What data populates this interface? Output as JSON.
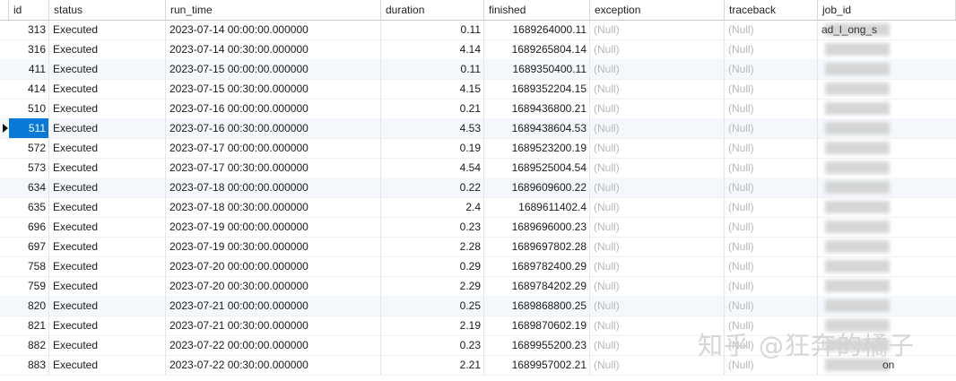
{
  "columns": [
    "id",
    "status",
    "run_time",
    "duration",
    "finished",
    "exception",
    "traceback",
    "job_id"
  ],
  "rows": [
    {
      "id": "313",
      "status": "Executed",
      "run_time": "2023-07-14 00:00:00.000000",
      "duration": "0.11",
      "finished": "1689264000.11",
      "exception": "(Null)",
      "traceback": "(Null)",
      "job_id": "ad_l_ong_s"
    },
    {
      "id": "316",
      "status": "Executed",
      "run_time": "2023-07-14 00:30:00.000000",
      "duration": "4.14",
      "finished": "1689265804.14",
      "exception": "(Null)",
      "traceback": "(Null)",
      "job_id": ""
    },
    {
      "id": "411",
      "status": "Executed",
      "run_time": "2023-07-15 00:00:00.000000",
      "duration": "0.11",
      "finished": "1689350400.11",
      "exception": "(Null)",
      "traceback": "(Null)",
      "job_id": ""
    },
    {
      "id": "414",
      "status": "Executed",
      "run_time": "2023-07-15 00:30:00.000000",
      "duration": "4.15",
      "finished": "1689352204.15",
      "exception": "(Null)",
      "traceback": "(Null)",
      "job_id": ""
    },
    {
      "id": "510",
      "status": "Executed",
      "run_time": "2023-07-16 00:00:00.000000",
      "duration": "0.21",
      "finished": "1689436800.21",
      "exception": "(Null)",
      "traceback": "(Null)",
      "job_id": ""
    },
    {
      "id": "511",
      "status": "Executed",
      "run_time": "2023-07-16 00:30:00.000000",
      "duration": "4.53",
      "finished": "1689438604.53",
      "exception": "(Null)",
      "traceback": "(Null)",
      "job_id": ""
    },
    {
      "id": "572",
      "status": "Executed",
      "run_time": "2023-07-17 00:00:00.000000",
      "duration": "0.19",
      "finished": "1689523200.19",
      "exception": "(Null)",
      "traceback": "(Null)",
      "job_id": ""
    },
    {
      "id": "573",
      "status": "Executed",
      "run_time": "2023-07-17 00:30:00.000000",
      "duration": "4.54",
      "finished": "1689525004.54",
      "exception": "(Null)",
      "traceback": "(Null)",
      "job_id": ""
    },
    {
      "id": "634",
      "status": "Executed",
      "run_time": "2023-07-18 00:00:00.000000",
      "duration": "0.22",
      "finished": "1689609600.22",
      "exception": "(Null)",
      "traceback": "(Null)",
      "job_id": ""
    },
    {
      "id": "635",
      "status": "Executed",
      "run_time": "2023-07-18 00:30:00.000000",
      "duration": "2.4",
      "finished": "1689611402.4",
      "exception": "(Null)",
      "traceback": "(Null)",
      "job_id": ""
    },
    {
      "id": "696",
      "status": "Executed",
      "run_time": "2023-07-19 00:00:00.000000",
      "duration": "0.23",
      "finished": "1689696000.23",
      "exception": "(Null)",
      "traceback": "(Null)",
      "job_id": ""
    },
    {
      "id": "697",
      "status": "Executed",
      "run_time": "2023-07-19 00:30:00.000000",
      "duration": "2.28",
      "finished": "1689697802.28",
      "exception": "(Null)",
      "traceback": "(Null)",
      "job_id": ""
    },
    {
      "id": "758",
      "status": "Executed",
      "run_time": "2023-07-20 00:00:00.000000",
      "duration": "0.29",
      "finished": "1689782400.29",
      "exception": "(Null)",
      "traceback": "(Null)",
      "job_id": ""
    },
    {
      "id": "759",
      "status": "Executed",
      "run_time": "2023-07-20 00:30:00.000000",
      "duration": "2.29",
      "finished": "1689784202.29",
      "exception": "(Null)",
      "traceback": "(Null)",
      "job_id": ""
    },
    {
      "id": "820",
      "status": "Executed",
      "run_time": "2023-07-21 00:00:00.000000",
      "duration": "0.25",
      "finished": "1689868800.25",
      "exception": "(Null)",
      "traceback": "(Null)",
      "job_id": ""
    },
    {
      "id": "821",
      "status": "Executed",
      "run_time": "2023-07-21 00:30:00.000000",
      "duration": "2.19",
      "finished": "1689870602.19",
      "exception": "(Null)",
      "traceback": "(Null)",
      "job_id": ""
    },
    {
      "id": "882",
      "status": "Executed",
      "run_time": "2023-07-22 00:00:00.000000",
      "duration": "0.23",
      "finished": "1689955200.23",
      "exception": "(Null)",
      "traceback": "(Null)",
      "job_id": ""
    },
    {
      "id": "883",
      "status": "Executed",
      "run_time": "2023-07-22 00:30:00.000000",
      "duration": "2.21",
      "finished": "1689957002.21",
      "exception": "(Null)",
      "traceback": "(Null)",
      "job_id": "on"
    }
  ],
  "selected_row_index": 5,
  "watermark": "知乎 @狂奔的橘子",
  "colors": {
    "selection": "#0a78d7",
    "null_text": "#b8b8b8",
    "alt_row": "#f4f8fc"
  }
}
